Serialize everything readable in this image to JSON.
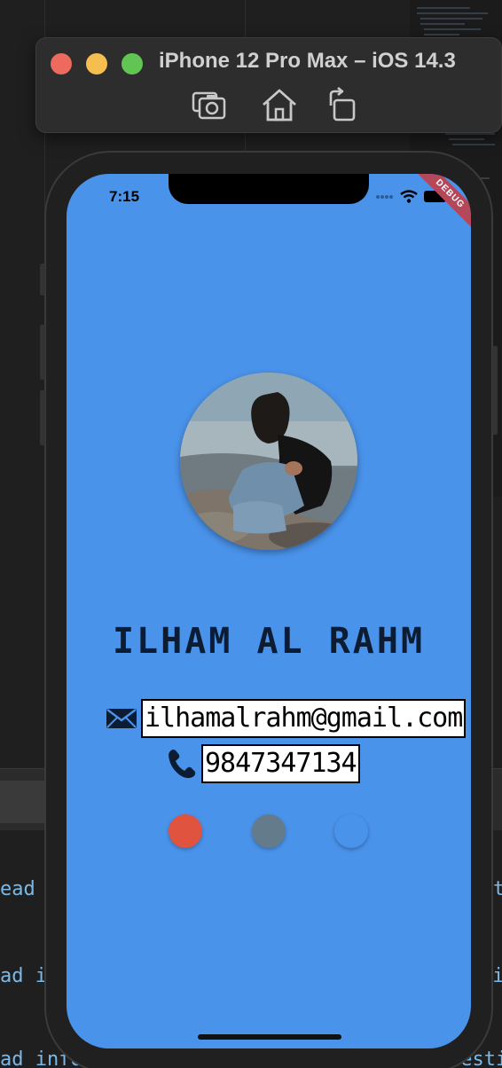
{
  "simulator": {
    "title": "iPhone 12 Pro Max – iOS 14.3",
    "tools": [
      "screenshot-icon",
      "home-icon",
      "rotate-icon"
    ]
  },
  "editor": {
    "fragments": [
      "ead",
      "ad i",
      "ad infor",
      "t",
      "ti",
      "uesti"
    ]
  },
  "status_bar": {
    "time": "7:15",
    "debug_label": "DEBUG"
  },
  "profile": {
    "name": "ILHAM AL RAHM",
    "email": "ilhamalrahm@gmail.com",
    "phone": "9847347134"
  },
  "colors": {
    "screen_bg": "#4a93eb",
    "dot_red": "#e0533f",
    "dot_grey": "#637b8a",
    "dot_blue": "#4a93eb"
  }
}
